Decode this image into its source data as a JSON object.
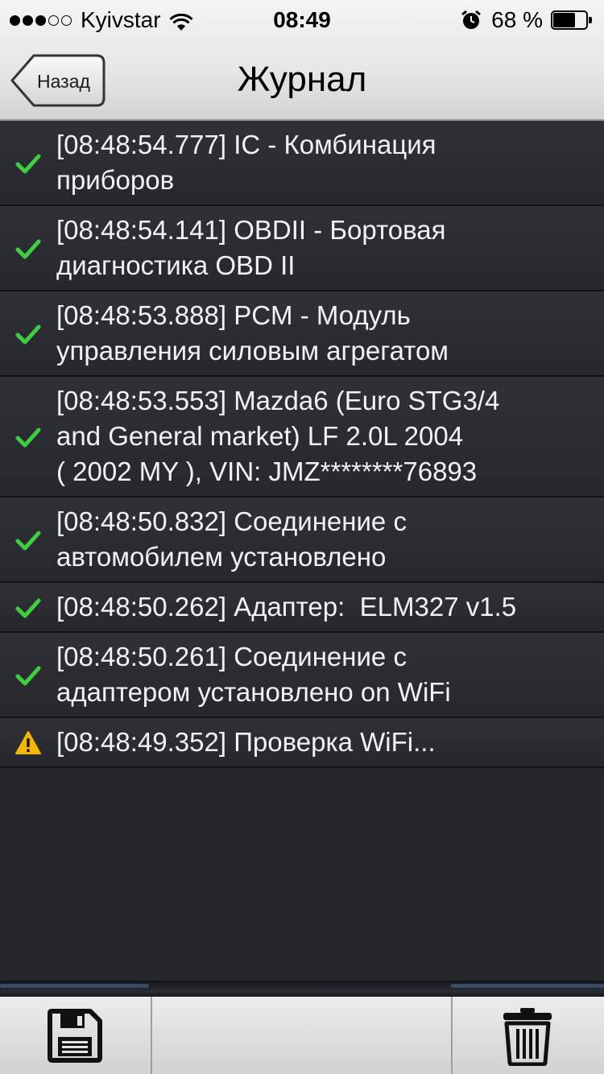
{
  "status_bar": {
    "carrier": "Kyivstar",
    "signal_bars_filled": 3,
    "signal_bars_total": 5,
    "time": "08:49",
    "battery_percent_label": "68 %",
    "battery_level": 0.68,
    "icons": [
      "wifi-icon",
      "alarm-icon",
      "battery-icon"
    ]
  },
  "nav": {
    "back_label": "Назад",
    "title": "Журнал"
  },
  "log": {
    "entries": [
      {
        "status": "success",
        "icon": "checkmark-icon",
        "text": "[08:48:54.777] IC - Комбинация\nприборов"
      },
      {
        "status": "success",
        "icon": "checkmark-icon",
        "text": "[08:48:54.141] OBDII - Бортовая\nдиагностика OBD II"
      },
      {
        "status": "success",
        "icon": "checkmark-icon",
        "text": "[08:48:53.888] PCM - Модуль\nуправления силовым агрегатом"
      },
      {
        "status": "success",
        "icon": "checkmark-icon",
        "text": "[08:48:53.553] Mazda6 (Euro STG3/4\nand General market) LF 2.0L 2004\n( 2002 MY ), VIN: JMZ********76893"
      },
      {
        "status": "success",
        "icon": "checkmark-icon",
        "text": "[08:48:50.832] Соединение с\nавтомобилем установлено"
      },
      {
        "status": "success",
        "icon": "checkmark-icon",
        "text": "[08:48:50.262] Адаптер:  ELM327 v1.5"
      },
      {
        "status": "success",
        "icon": "checkmark-icon",
        "text": "[08:48:50.261] Соединение с\nадаптером установлено on WiFi"
      },
      {
        "status": "warning",
        "icon": "warning-icon",
        "text": "[08:48:49.352] Проверка WiFi..."
      }
    ]
  },
  "toolbar": {
    "save_icon": "floppy-disk-icon",
    "delete_icon": "trash-icon"
  },
  "colors": {
    "success": "#3ecf3e",
    "warning": "#f5b800",
    "background": "#24262c",
    "text": "#f2f2f2"
  }
}
